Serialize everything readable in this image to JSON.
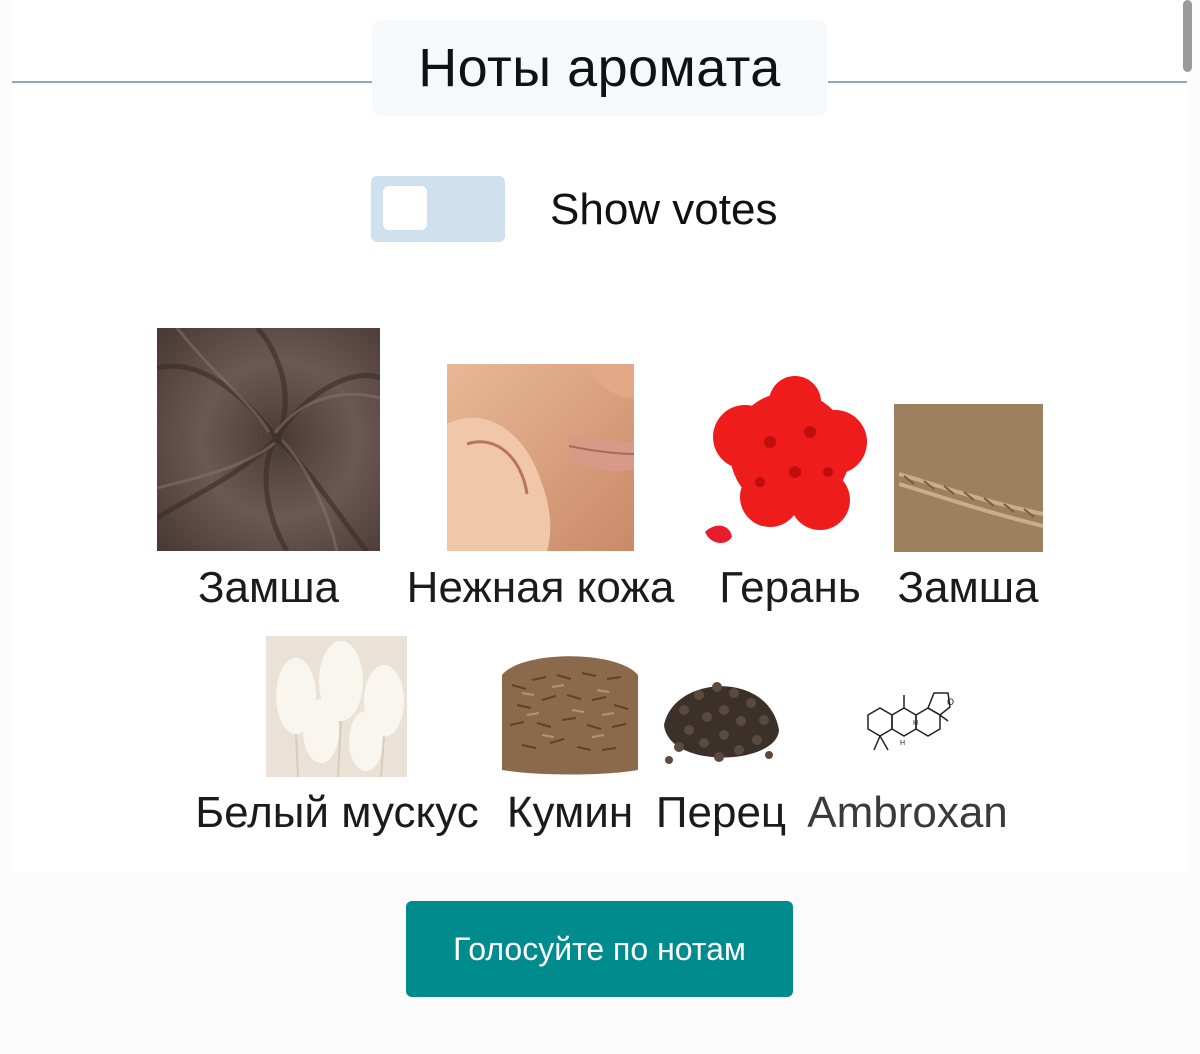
{
  "section": {
    "title": "Ноты аромата"
  },
  "toggle": {
    "label": "Show votes",
    "state": "off"
  },
  "notes": [
    {
      "name": "Замша",
      "icon": "suede-fabric-image"
    },
    {
      "name": "Нежная кожа",
      "icon": "soft-skin-image"
    },
    {
      "name": "Герань",
      "icon": "geranium-flower-image"
    },
    {
      "name": "Замша",
      "icon": "suede-leather-image"
    },
    {
      "name": "Белый мускус",
      "icon": "white-musk-image"
    },
    {
      "name": "Кумин",
      "icon": "cumin-seeds-image"
    },
    {
      "name": "Перец",
      "icon": "black-pepper-image"
    },
    {
      "name": "Ambroxan",
      "icon": "ambroxan-molecule-image"
    }
  ],
  "vote_button": {
    "label": "Голосуйте по нотам"
  },
  "colors": {
    "accent": "#008b8e",
    "toggle_bg": "#cfe0ee",
    "divider": "#8fa9b8",
    "title_bg": "#f6f9fc"
  }
}
